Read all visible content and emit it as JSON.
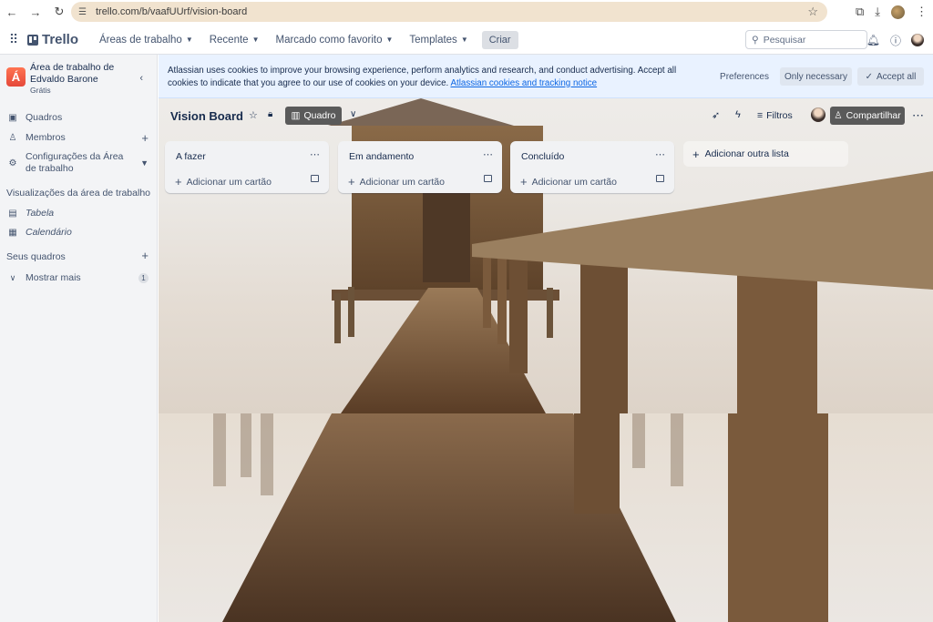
{
  "browser": {
    "url": "trello.com/b/vaafUUrf/vision-board"
  },
  "header": {
    "brand": "Trello",
    "menu": [
      {
        "label": "Áreas de trabalho"
      },
      {
        "label": "Recente"
      },
      {
        "label": "Marcado como favorito"
      },
      {
        "label": "Templates"
      }
    ],
    "create_label": "Criar",
    "search_placeholder": "Pesquisar"
  },
  "sidebar": {
    "workspace_initial": "Á",
    "workspace_name": "Área de trabalho de Edvaldo Barone",
    "workspace_plan": "Grátis",
    "items": [
      {
        "label": "Quadros"
      },
      {
        "label": "Membros"
      },
      {
        "label": "Configurações da Área de trabalho"
      }
    ],
    "views_heading": "Visualizações da área de trabalho",
    "views": [
      {
        "label": "Tabela"
      },
      {
        "label": "Calendário"
      }
    ],
    "boards_heading": "Seus quadros",
    "show_more_label": "Mostrar mais",
    "show_more_count": "1"
  },
  "cookie_banner": {
    "text": "Atlassian uses cookies to improve your browsing experience, perform analytics and research, and conduct advertising. Accept all cookies to indicate that you agree to our use of cookies on your device.",
    "link": "Atlassian cookies and tracking notice",
    "preferences_label": "Preferences",
    "necessary_label": "Only necessary",
    "accept_label": "Accept all"
  },
  "board": {
    "title": "Vision Board",
    "view_label": "Quadro",
    "filters_label": "Filtros",
    "share_label": "Compartilhar",
    "lists": [
      {
        "title": "A fazer",
        "add_card": "Adicionar um cartão"
      },
      {
        "title": "Em andamento",
        "add_card": "Adicionar um cartão"
      },
      {
        "title": "Concluído",
        "add_card": "Adicionar um cartão"
      }
    ],
    "add_list_label": "Adicionar outra lista"
  },
  "colors": {
    "accent_blue": "#0c66e4",
    "workspace_avatar": "#e5493a",
    "dark_button": "#5a5a5a"
  }
}
